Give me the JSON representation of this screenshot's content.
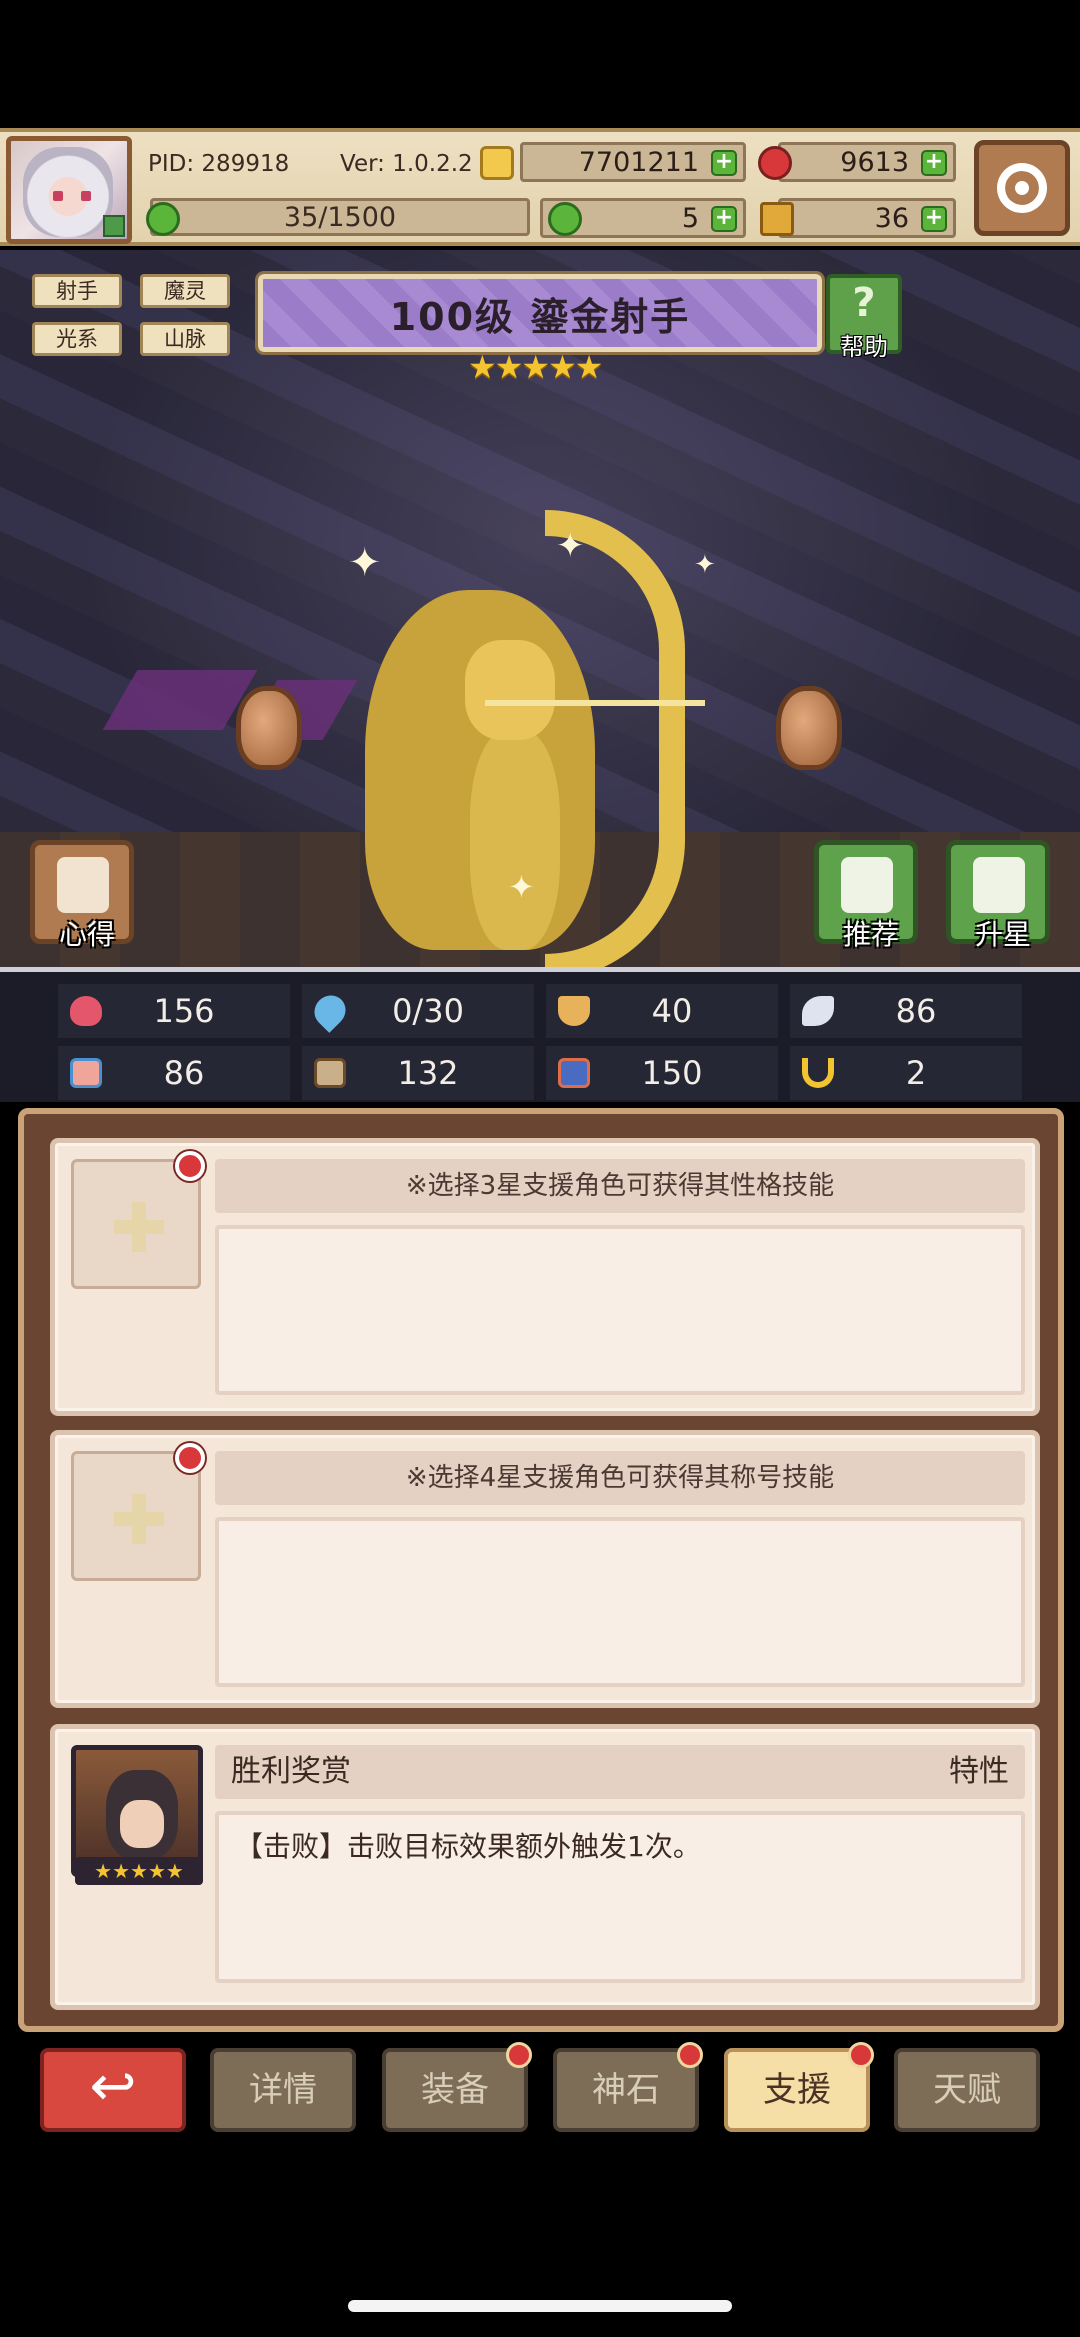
{
  "header": {
    "pid": "PID: 289918",
    "version": "Ver: 1.0.2.2",
    "gold": "7701211",
    "gems": "9613",
    "clover": "5",
    "key": "36",
    "stamina": "35/1500",
    "colors": {
      "gold_icon": "#f2c94c",
      "gem_icon": "#d8383a",
      "clover_icon": "#5ab53a",
      "key_icon": "#e0a93a"
    }
  },
  "character": {
    "tags": [
      "射手",
      "魔灵",
      "光系",
      "山脉"
    ],
    "title": "100级 鎏金射手",
    "stars": "★★★★★",
    "star_count": 5,
    "help_label": "帮助",
    "help_symbol": "?"
  },
  "side_buttons": {
    "notes_label": "心得",
    "recommend_label": "推荐",
    "upgrade_label": "升星"
  },
  "stats": [
    {
      "icon": "heart-icon",
      "value": "156",
      "color": "#e4566b"
    },
    {
      "icon": "water-drop-icon",
      "value": "0/30",
      "color": "#69b7e6"
    },
    {
      "icon": "shield-icon",
      "value": "40",
      "color": "#e8b25a"
    },
    {
      "icon": "wing-icon",
      "value": "86",
      "color": "#dfe3ef"
    },
    {
      "icon": "fist-icon",
      "value": "86",
      "color": "#f0a59a"
    },
    {
      "icon": "book-icon",
      "value": "132",
      "color": "#c9b08a"
    },
    {
      "icon": "scroll-icon",
      "value": "150",
      "color": "#e06d4a"
    },
    {
      "icon": "horseshoe-icon",
      "value": "2",
      "color": "#f2c430"
    }
  ],
  "support": {
    "slot1_hint": "※选择3星支援角色可获得其性格技能",
    "slot2_hint": "※选择4星支援角色可获得其称号技能",
    "reward": {
      "name": "胜利奖赏",
      "type": "特性",
      "description": "【击败】击败目标效果额外触发1次。",
      "stars": "★★★★★"
    }
  },
  "tabs": {
    "back_symbol": "↩",
    "details": "详情",
    "equipment": "装备",
    "godstone": "神石",
    "support": "支援",
    "talent": "天赋"
  }
}
